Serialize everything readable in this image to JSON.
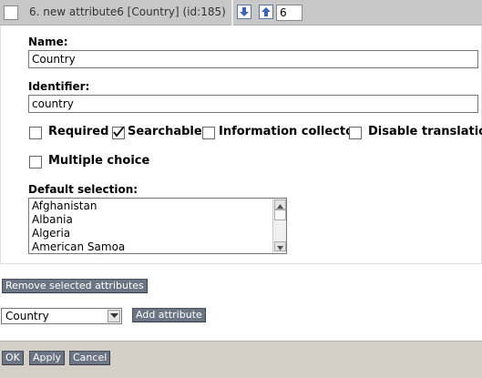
{
  "attribute": {
    "title": "6. new attribute6 [Country] (id:185)",
    "priority": "6",
    "name_label": "Name:",
    "name_value": "Country",
    "identifier_label": "Identifier:",
    "identifier_value": "country",
    "options": {
      "required": {
        "label": "Required",
        "checked": false
      },
      "searchable": {
        "label": "Searchable",
        "checked": true
      },
      "information_collector": {
        "label": "Information collector",
        "checked": false
      },
      "disable_translation": {
        "label": "Disable translation",
        "checked": false
      },
      "multiple_choice": {
        "label": "Multiple choice",
        "checked": false
      }
    },
    "default_selection_label": "Default selection:",
    "default_selection_items": [
      "Afghanistan",
      "Albania",
      "Algeria",
      "American Samoa"
    ]
  },
  "actions": {
    "remove_selected": "Remove selected attributes",
    "datatype_select_value": "Country",
    "add_attribute": "Add attribute"
  },
  "footer": {
    "ok": "OK",
    "apply": "Apply",
    "cancel": "Cancel"
  },
  "icons": {
    "move_down": "arrow-down-icon",
    "move_up": "arrow-up-icon",
    "checkmark": "checkmark-icon",
    "dropdown": "chevron-down-icon"
  },
  "colors": {
    "header_bg": "#c8c8c8",
    "arrow_blue": "#3c64b4",
    "button_gray": "#6c7584",
    "footer_bg": "#d4d0c8"
  }
}
